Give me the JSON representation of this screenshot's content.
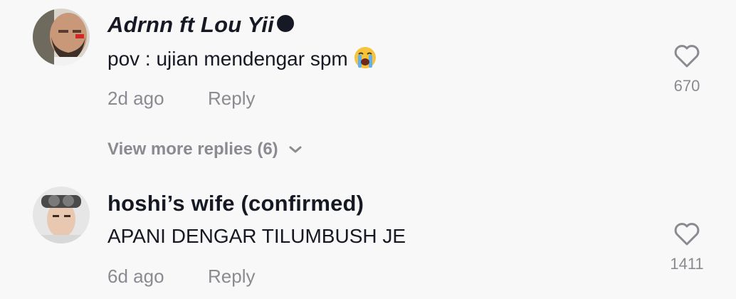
{
  "comments": [
    {
      "username": "Adrnn ft Lou Yii",
      "text": "pov : ujian mendengar spm",
      "time": "2d ago",
      "reply_label": "Reply",
      "likes": "670",
      "avatar_icon": "avatar-photo-man-beard",
      "text_emoji": "loudly-crying-face-emoji",
      "name_emoji": "half-moon-emoji"
    },
    {
      "username": "hoshi’s wife (confirmed)",
      "text": "APANI DENGAR TILUMBUSH JE",
      "time": "6d ago",
      "reply_label": "Reply",
      "likes": "1411",
      "avatar_icon": "avatar-photo-man-goggles"
    }
  ],
  "view_more_replies": "View more replies (6)",
  "colors": {
    "background": "#f8f8f8",
    "primary_text": "#161823",
    "secondary_text": "#8a8b91"
  }
}
